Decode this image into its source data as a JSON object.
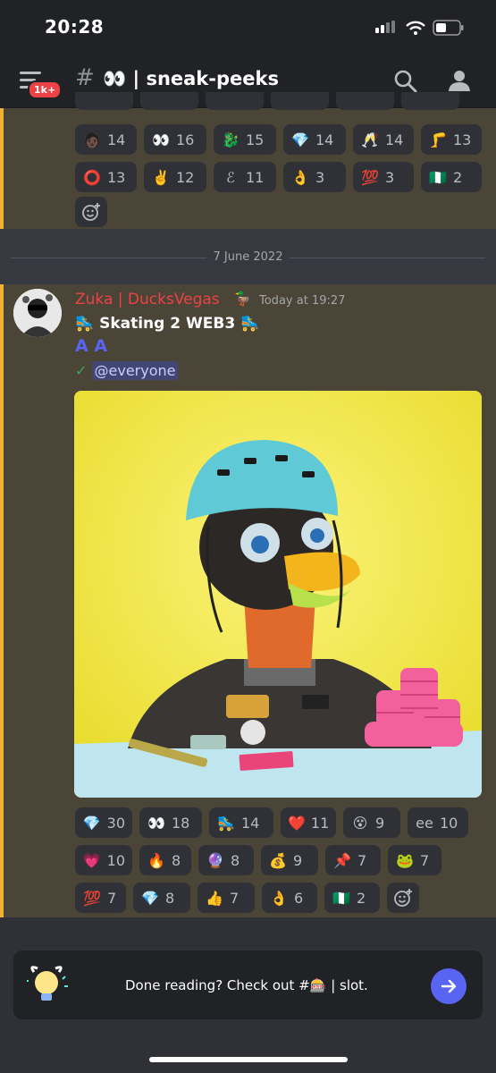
{
  "status": {
    "time": "20:28"
  },
  "header": {
    "badge": "1k+",
    "hash": "#",
    "channel": "👀 | sneak-peeks"
  },
  "prev_reactions_row1": [
    {
      "emoji": "🧑🏿",
      "count": "14"
    },
    {
      "emoji": "👀",
      "count": "16"
    },
    {
      "emoji": "🐉",
      "count": "15"
    },
    {
      "emoji": "💎",
      "count": "14"
    },
    {
      "emoji": "🥂",
      "count": "14"
    },
    {
      "emoji": "🦵",
      "count": "13"
    }
  ],
  "prev_reactions_row2": [
    {
      "emoji": "⭕",
      "count": "13"
    },
    {
      "emoji": "✌️",
      "count": "12"
    },
    {
      "emoji": "ℰ",
      "count": "11"
    },
    {
      "emoji": "👌",
      "count": "3"
    },
    {
      "emoji": "💯",
      "count": "3"
    },
    {
      "emoji": "🇳🇬",
      "count": "2"
    }
  ],
  "date_divider": "7 June 2022",
  "message": {
    "author": "Zuka | DucksVegas",
    "author_badge": "🦆",
    "timestamp": "Today at 19:27",
    "line1": "🛼 Skating 2 WEB3 🛼",
    "line2": "A A",
    "check": "✓",
    "mention": "@everyone"
  },
  "reactions_row1": [
    {
      "emoji": "💎",
      "count": "30"
    },
    {
      "emoji": "👀",
      "count": "18"
    },
    {
      "emoji": "🛼",
      "count": "14"
    },
    {
      "emoji": "❤️",
      "count": "11"
    },
    {
      "emoji": "😵",
      "count": "9"
    },
    {
      "emoji": "ee",
      "count": "10"
    }
  ],
  "reactions_row2": [
    {
      "emoji": "💗",
      "count": "10"
    },
    {
      "emoji": "🔥",
      "count": "8"
    },
    {
      "emoji": "🔮",
      "count": "8"
    },
    {
      "emoji": "💰",
      "count": "9"
    },
    {
      "emoji": "📌",
      "count": "7"
    },
    {
      "emoji": "🐸",
      "count": "7"
    }
  ],
  "reactions_row3": [
    {
      "emoji": "💯",
      "count": "7"
    },
    {
      "emoji": "💎",
      "count": "8"
    },
    {
      "emoji": "👍",
      "count": "7"
    },
    {
      "emoji": "👌",
      "count": "6"
    },
    {
      "emoji": "🇳🇬",
      "count": "2"
    }
  ],
  "banner": {
    "text": "Done reading? Check out #🎰 | slot."
  }
}
